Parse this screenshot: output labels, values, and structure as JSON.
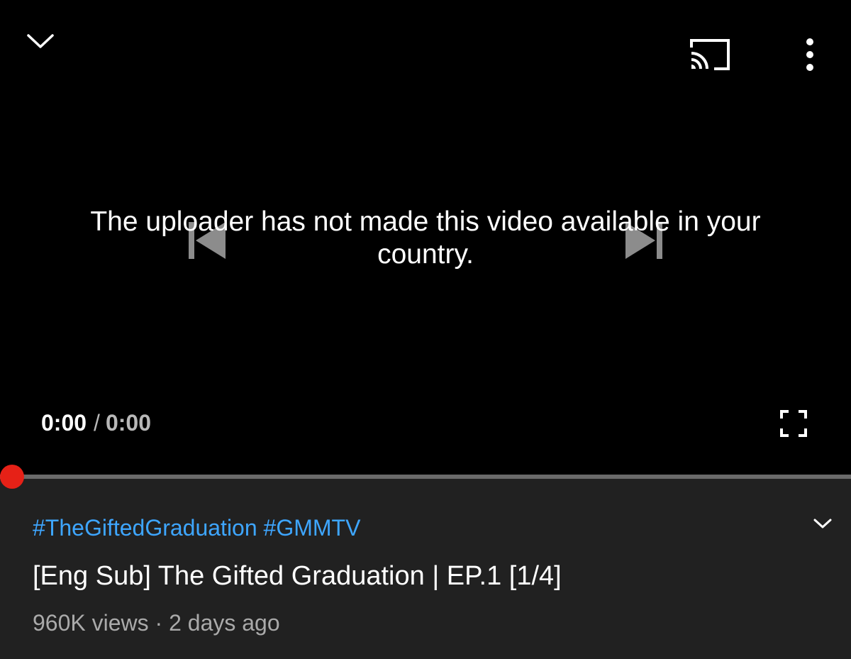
{
  "player": {
    "error_message": "The uploader has not made this video available in your country.",
    "time_current": "0:00",
    "time_separator": "/",
    "time_duration": "0:00",
    "progress_fraction": 0,
    "icons": {
      "collapse": "chevron-down-icon",
      "cast": "cast-icon",
      "more": "more-vert-icon",
      "previous": "skip-previous-icon",
      "next": "skip-next-icon",
      "fullscreen": "fullscreen-icon"
    }
  },
  "video": {
    "hashtags": [
      "#TheGiftedGraduation",
      "#GMMTV"
    ],
    "title": "[Eng Sub] The Gifted Graduation | EP.1 [1/4]",
    "views": "960K views",
    "meta_separator": " · ",
    "age": "2 days ago",
    "expand_icon": "chevron-down-icon"
  },
  "colors": {
    "player_background": "#000000",
    "page_background": "#212121",
    "hashtag_link": "#3ea6ff",
    "progress_handle": "#e62117",
    "progress_track": "#6a6a6a",
    "secondary_text": "#aaaaaa"
  }
}
